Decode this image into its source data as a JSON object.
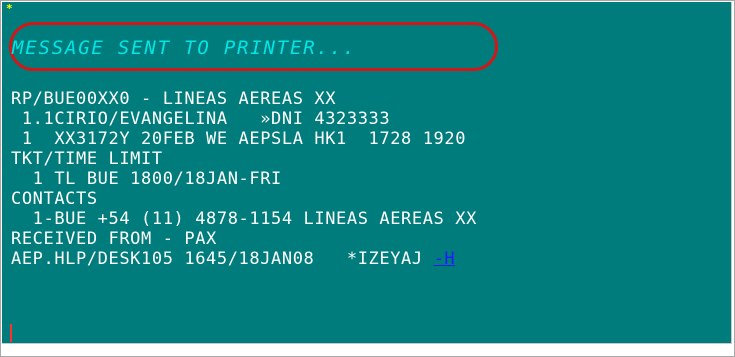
{
  "terminal": {
    "cursor_glyph": "*",
    "message": "MESSAGE SENT TO PRINTER...",
    "lines": [
      "RP/BUE00XX0 - LINEAS AEREAS XX",
      " 1.1CIRIO/EVANGELINA   »DNI 4323333",
      " 1  XX3172Y 20FEB WE AEPSLA HK1  1728 1920",
      "TKT/TIME LIMIT",
      "  1 TL BUE 1800/18JAN-FRI",
      "CONTACTS",
      "  1-BUE +54 (11) 4878-1154 LINEAS AEREAS XX",
      "RECEIVED FROM - PAX",
      "AEP.HLP/DESK105 1645/18JAN08   *IZEYAJ "
    ],
    "link_text": "-H"
  },
  "colors": {
    "background": "#007c7c",
    "text": "#ffffff",
    "message": "#00e5e5",
    "highlight": "#d01818",
    "link": "#1a1aff",
    "cursor": "#ffff00"
  }
}
